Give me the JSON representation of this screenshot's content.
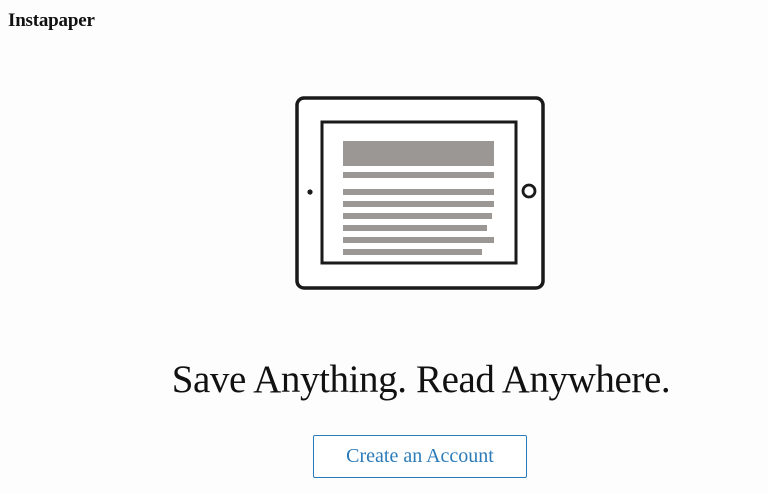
{
  "header": {
    "brand": "Instapaper"
  },
  "hero": {
    "illustration_icon": "tablet-article-icon",
    "headline": "Save Anything. Read Anywhere.",
    "cta_label": "Create an Account"
  },
  "colors": {
    "accent": "#2b7bb9",
    "text": "#111111",
    "device_outline": "#1a1a1a",
    "article_lines": "#9b9795",
    "background": "#fdfdfd"
  }
}
